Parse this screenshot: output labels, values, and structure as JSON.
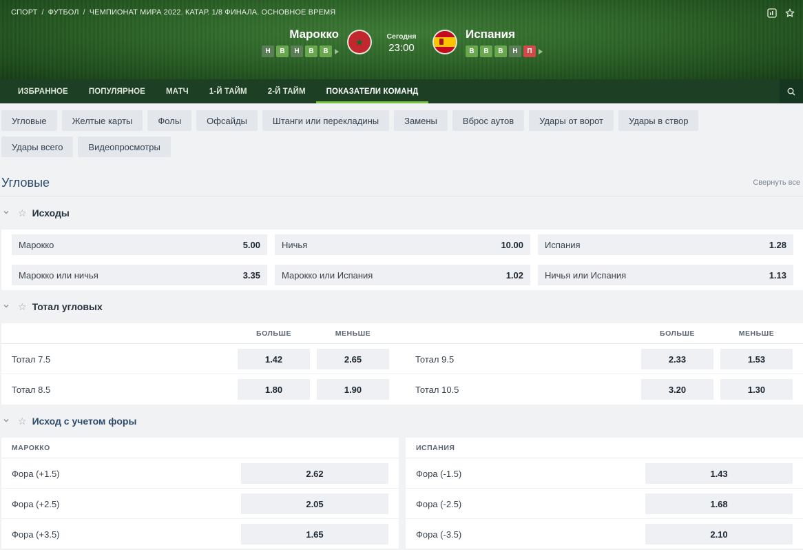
{
  "breadcrumb": [
    "СПОРТ",
    "ФУТБОЛ",
    "ЧЕМПИОНАТ МИРА 2022. КАТАР. 1/8 ФИНАЛА. ОСНОВНОЕ ВРЕМЯ"
  ],
  "match": {
    "home": {
      "name": "Марокко",
      "form": [
        "Н",
        "В",
        "Н",
        "В",
        "В"
      ]
    },
    "away": {
      "name": "Испания",
      "form": [
        "В",
        "В",
        "В",
        "Н",
        "П"
      ]
    },
    "date_label": "Сегодня",
    "time": "23:00"
  },
  "nav": {
    "tabs": [
      "ИЗБРАННОЕ",
      "ПОПУЛЯРНОЕ",
      "МАТЧ",
      "1-Й ТАЙМ",
      "2-Й ТАЙМ",
      "ПОКАЗАТЕЛИ КОМАНД"
    ],
    "active": 5
  },
  "chips": [
    "Угловые",
    "Желтые карты",
    "Фолы",
    "Офсайды",
    "Штанги или перекладины",
    "Замены",
    "Вброс аутов",
    "Удары от ворот",
    "Удары в створ",
    "Удары всего",
    "Видеопросмотры"
  ],
  "section": {
    "title": "Угловые",
    "collapse_label": "Свернуть все"
  },
  "outcomes": {
    "title": "Исходы",
    "items": [
      {
        "label": "Марокко",
        "odd": "5.00"
      },
      {
        "label": "Ничья",
        "odd": "10.00"
      },
      {
        "label": "Испания",
        "odd": "1.28"
      },
      {
        "label": "Марокко или ничья",
        "odd": "3.35"
      },
      {
        "label": "Марокко или Испания",
        "odd": "1.02"
      },
      {
        "label": "Ничья или Испания",
        "odd": "1.13"
      }
    ]
  },
  "totals": {
    "title": "Тотал угловых",
    "over_label": "БОЛЬШЕ",
    "under_label": "МЕНЬШЕ",
    "rows": [
      {
        "left": {
          "label": "Тотал 7.5",
          "over": "1.42",
          "under": "2.65"
        },
        "right": {
          "label": "Тотал 9.5",
          "over": "2.33",
          "under": "1.53"
        }
      },
      {
        "left": {
          "label": "Тотал 8.5",
          "over": "1.80",
          "under": "1.90"
        },
        "right": {
          "label": "Тотал 10.5",
          "over": "3.20",
          "under": "1.30"
        }
      }
    ]
  },
  "handicap": {
    "title": "Исход с учетом форы",
    "home_label": "МАРОККО",
    "away_label": "ИСПАНИЯ",
    "home_rows": [
      {
        "label": "Фора (+1.5)",
        "odd": "2.62"
      },
      {
        "label": "Фора (+2.5)",
        "odd": "2.05"
      },
      {
        "label": "Фора (+3.5)",
        "odd": "1.65"
      }
    ],
    "away_rows": [
      {
        "label": "Фора (-1.5)",
        "odd": "1.43"
      },
      {
        "label": "Фора (-2.5)",
        "odd": "1.68"
      },
      {
        "label": "Фора (-3.5)",
        "odd": "2.10"
      }
    ]
  },
  "colors": {
    "accent": "#7bc142",
    "nav_bg": "#1d3f24",
    "win": "#6aa84f",
    "draw": "#5b7e57",
    "loss": "#d04a4a"
  },
  "icons": [
    "stats-icon",
    "star-icon",
    "search-icon",
    "chevron-down-icon"
  ]
}
